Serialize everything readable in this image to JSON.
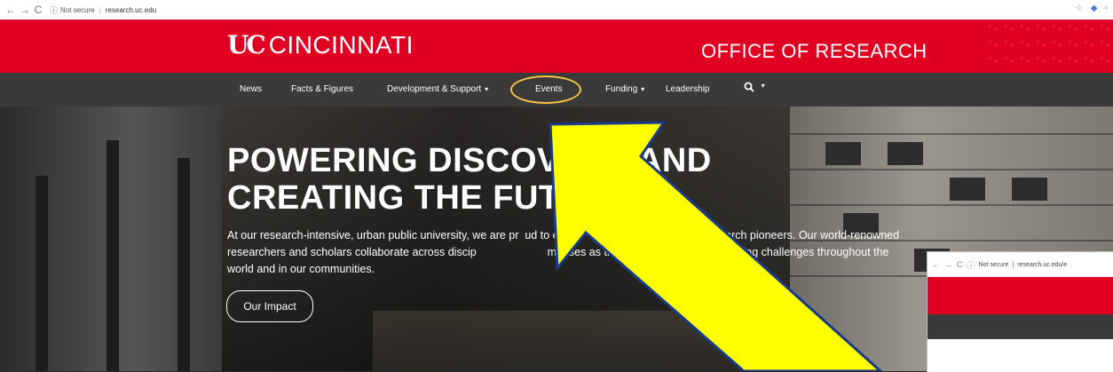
{
  "browser": {
    "back_icon": "←",
    "forward_icon": "→",
    "reload_icon": "C",
    "security_label": "Not secure",
    "url": "research.uc.edu"
  },
  "header": {
    "logo_mark": "UC",
    "logo_text": "CINCINNATI",
    "office": "OFFICE OF RESEARCH",
    "color": "#e00122"
  },
  "nav": {
    "items": [
      {
        "label": "News"
      },
      {
        "label": "Facts & Figures"
      },
      {
        "label": "Development & Support",
        "caret": "▾"
      },
      {
        "label": "Events"
      },
      {
        "label": "Funding",
        "caret": "▾"
      },
      {
        "label": "Leadership"
      }
    ],
    "search_icon": "search-icon",
    "search_caret": "▾"
  },
  "hero": {
    "title_line1": "POWERING DISCOV        AND",
    "title_line2": "CREATING THE FUT",
    "text": "At our research-intensive, urban public university, we are pr  ud to e                               eration of research pioneers. Our world-renowned researchers and scholars collaborate across discip                       mpuses as they address the most pressing challenges throughout the world and in our communities.",
    "button": "Our Impact"
  },
  "annotation": {
    "arrow_color": "#ffff00",
    "circle_color": "#f5c241"
  },
  "inset": {
    "security_label": "Not secure",
    "url": "research.uc.edu/e"
  }
}
